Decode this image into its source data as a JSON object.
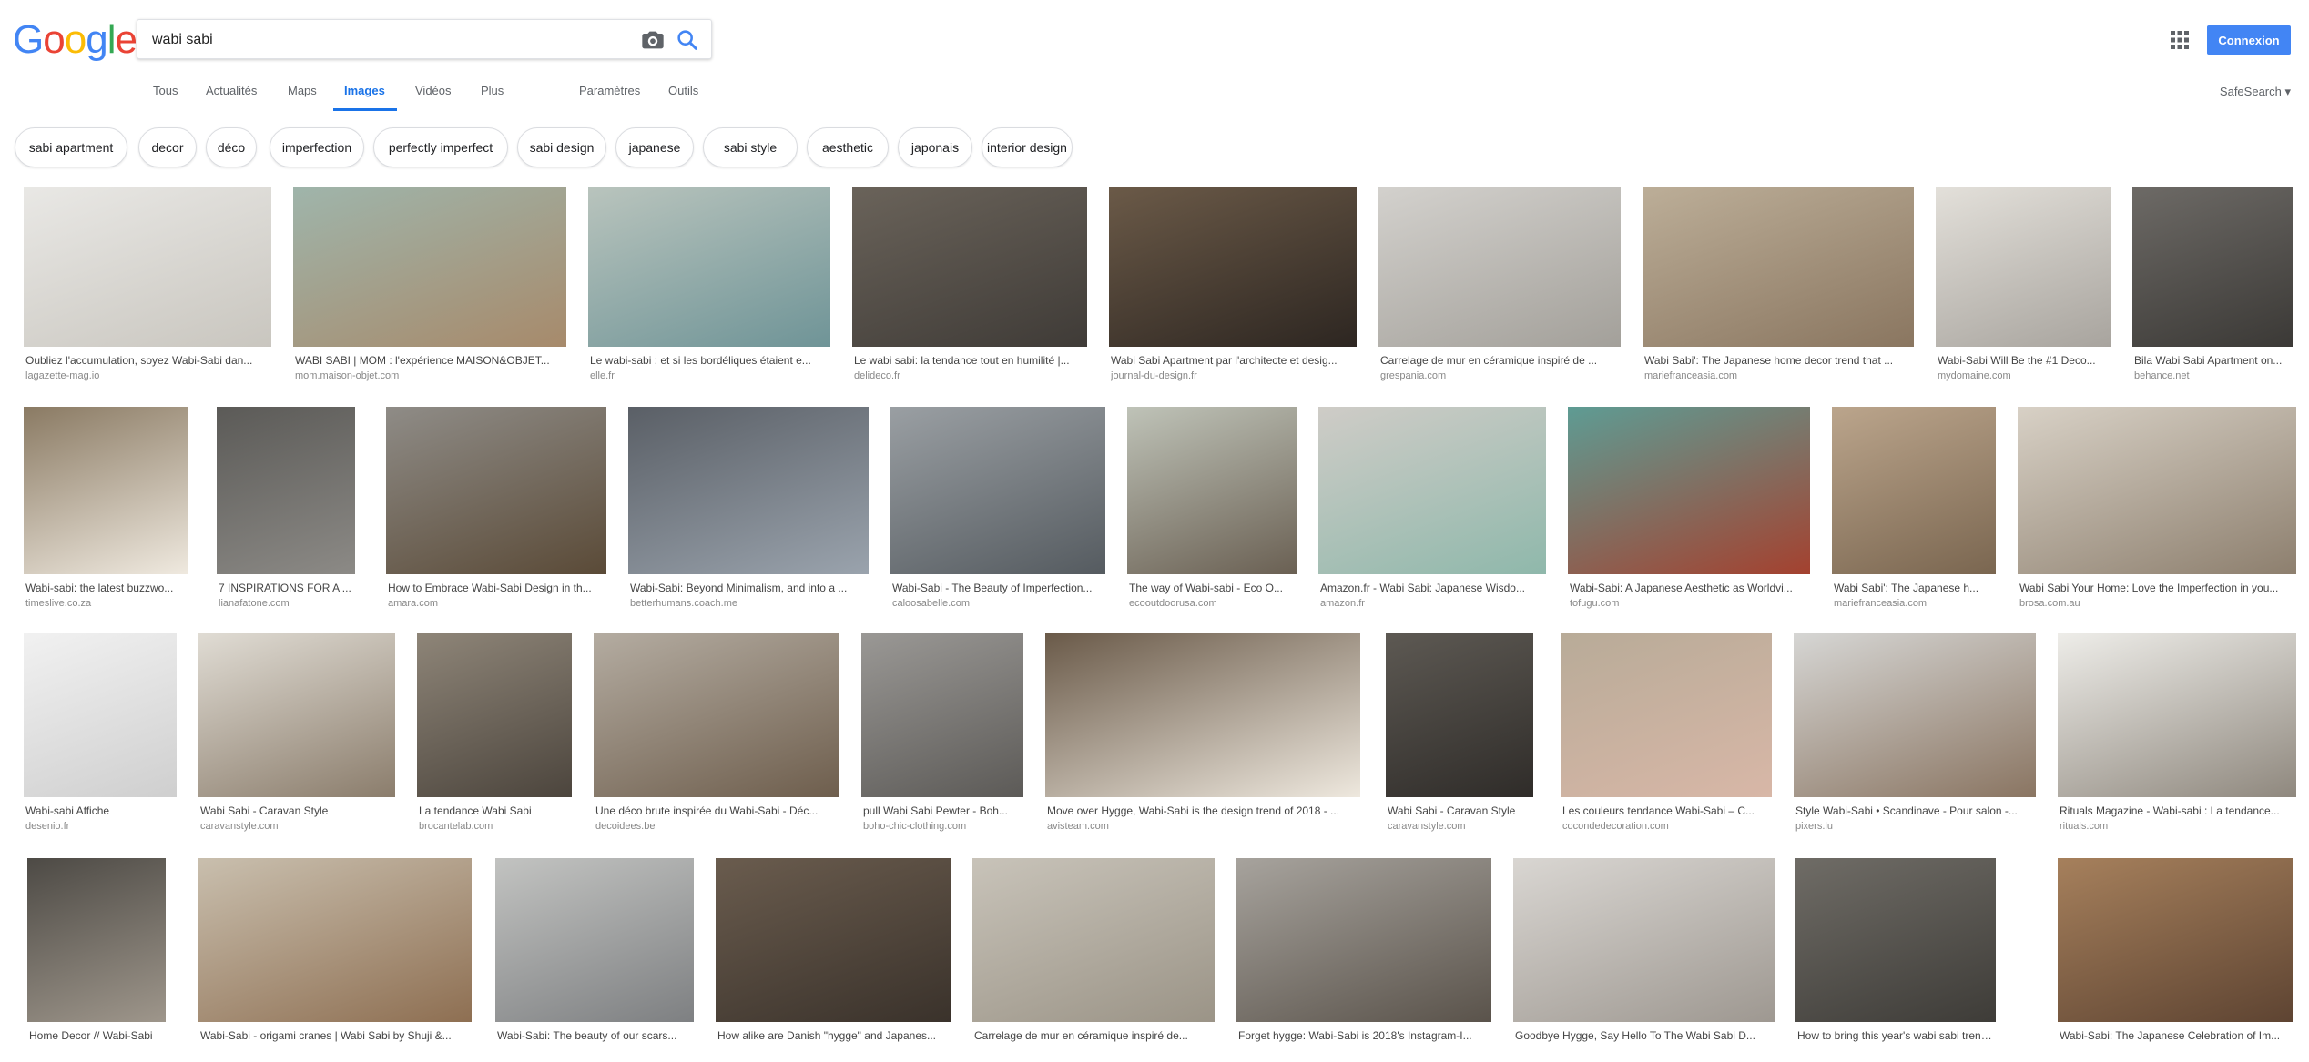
{
  "header": {
    "logo": "Google",
    "logo_colors": [
      "#4285f4",
      "#ea4335",
      "#fbbc05",
      "#4285f4",
      "#34a853",
      "#ea4335"
    ],
    "search_value": "wabi sabi",
    "signin_label": "Connexion",
    "safesearch": "SafeSearch ▾"
  },
  "tabs": [
    {
      "label": "Tous"
    },
    {
      "label": "Actualités"
    },
    {
      "label": "Maps"
    },
    {
      "label": "Images",
      "active": true
    },
    {
      "label": "Vidéos"
    },
    {
      "label": "Plus"
    },
    {
      "label": "Paramètres"
    },
    {
      "label": "Outils"
    }
  ],
  "chips": [
    "sabi apartment",
    "decor",
    "déco",
    "imperfection",
    "perfectly imperfect",
    "sabi design",
    "japanese",
    "sabi style",
    "aesthetic",
    "japonais",
    "interior design"
  ],
  "rows": [
    {
      "tiles": [
        {
          "caption": "Oubliez l'accumulation, soyez Wabi-Sabi dan...",
          "domain": "lagazette-mag.io",
          "c1": "#e9e8e5",
          "c2": "#c9c6bf"
        },
        {
          "caption": "WABI SABI | MOM : l'expérience MAISON&OBJET...",
          "domain": "mom.maison-objet.com",
          "c1": "#9fb5ab",
          "c2": "#a78a6b"
        },
        {
          "caption": "Le wabi-sabi : et si les bordéliques étaient e...",
          "domain": "elle.fr",
          "c1": "#b9c4bd",
          "c2": "#6f9497"
        },
        {
          "caption": "Le wabi sabi: la tendance tout en humilité |...",
          "domain": "delideco.fr",
          "c1": "#6a635a",
          "c2": "#3f3b37"
        },
        {
          "caption": "Wabi Sabi Apartment par l'architecte et desig...",
          "domain": "journal-du-design.fr",
          "c1": "#6b5a48",
          "c2": "#2d2621"
        },
        {
          "caption": "Carrelage de mur en céramique inspiré de ...",
          "domain": "grespania.com",
          "c1": "#d3d1cd",
          "c2": "#a3a09a"
        },
        {
          "caption": "Wabi Sabi': The Japanese home decor trend that ...",
          "domain": "mariefranceasia.com",
          "c1": "#bcae98",
          "c2": "#8a7660"
        },
        {
          "caption": "Wabi-Sabi Will Be the #1 Deco...",
          "domain": "mydomaine.com",
          "c1": "#e3e0da",
          "c2": "#a8a49e"
        },
        {
          "caption": "Bila Wabi Sabi Apartment on...",
          "domain": "behance.net",
          "c1": "#6d6a66",
          "c2": "#3b3936"
        }
      ]
    },
    {
      "tiles": [
        {
          "caption": "Wabi-sabi: the latest buzzwo...",
          "domain": "timeslive.co.za",
          "c1": "#8a7a63",
          "c2": "#efe9df"
        },
        {
          "caption": "7 INSPIRATIONS FOR A ...",
          "domain": "lianafatone.com",
          "c1": "#5b5a57",
          "c2": "#8c8a86"
        },
        {
          "caption": "How to Embrace Wabi-Sabi Design in th...",
          "domain": "amara.com",
          "c1": "#8f8c87",
          "c2": "#5a4a37"
        },
        {
          "caption": "Wabi-Sabi: Beyond Minimalism, and into a ...",
          "domain": "betterhumans.coach.me",
          "c1": "#5a5f66",
          "c2": "#9aa3ad"
        },
        {
          "caption": "Wabi-Sabi - The Beauty of Imperfection...",
          "domain": "caloosabelle.com",
          "c1": "#9a9fa3",
          "c2": "#555b60"
        },
        {
          "caption": "The way of Wabi-sabi - Eco O...",
          "domain": "ecooutdoorusa.com",
          "c1": "#bfc3b8",
          "c2": "#6a6053"
        },
        {
          "caption": "Amazon.fr - Wabi Sabi: Japanese Wisdo...",
          "domain": "amazon.fr",
          "c1": "#cfccc7",
          "c2": "#8fb8ab"
        },
        {
          "caption": "Wabi-Sabi: A Japanese Aesthetic as Worldvi...",
          "domain": "tofugu.com",
          "c1": "#5e9c94",
          "c2": "#a4412f"
        },
        {
          "caption": "Wabi Sabi': The Japanese h...",
          "domain": "mariefranceasia.com",
          "c1": "#bba58c",
          "c2": "#7a6650"
        },
        {
          "caption": "Wabi Sabi Your Home: Love the Imperfection in you...",
          "domain": "brosa.com.au",
          "c1": "#d8d1c6",
          "c2": "#8d7f6e"
        }
      ]
    },
    {
      "tiles": [
        {
          "caption": "Wabi-sabi Affiche",
          "domain": "desenio.fr",
          "c1": "#f1f1f1",
          "c2": "#cfcfcf"
        },
        {
          "caption": "Wabi Sabi - Caravan Style",
          "domain": "caravanstyle.com",
          "c1": "#e0dcd4",
          "c2": "#8b7d6c"
        },
        {
          "caption": "La tendance Wabi Sabi",
          "domain": "brocantelab.com",
          "c1": "#8e8578",
          "c2": "#4c453d"
        },
        {
          "caption": "Une déco brute inspirée du Wabi-Sabi - Déc...",
          "domain": "decoidees.be",
          "c1": "#b4aca1",
          "c2": "#6e5e4d"
        },
        {
          "caption": "pull Wabi Sabi Pewter - Boh...",
          "domain": "boho-chic-clothing.com",
          "c1": "#9a9895",
          "c2": "#5c5a57"
        },
        {
          "caption": "Move over Hygge, Wabi-Sabi is the design trend of 2018 - ...",
          "domain": "avisteam.com",
          "c1": "#6a5a49",
          "c2": "#eee8de"
        },
        {
          "caption": "Wabi Sabi - Caravan Style",
          "domain": "caravanstyle.com",
          "c1": "#5d5953",
          "c2": "#2f2c29"
        },
        {
          "caption": "Les couleurs tendance Wabi-Sabi – C...",
          "domain": "cocondedecoration.com",
          "c1": "#b8ab98",
          "c2": "#d8b7a7"
        },
        {
          "caption": "Style Wabi-Sabi • Scandinave - Pour salon -...",
          "domain": "pixers.lu",
          "c1": "#d6d6d4",
          "c2": "#8a7562"
        },
        {
          "caption": "Rituals Magazine - Wabi-sabi : La tendance...",
          "domain": "rituals.com",
          "c1": "#eeede9",
          "c2": "#8f887e"
        }
      ]
    },
    {
      "tiles": [
        {
          "caption": "Home Decor // Wabi-Sabi",
          "domain": "",
          "c1": "#4d4a45",
          "c2": "#9e968b"
        },
        {
          "caption": "Wabi-Sabi - origami cranes | Wabi Sabi by Shuji &...",
          "domain": "",
          "c1": "#c9bfae",
          "c2": "#8e6f52"
        },
        {
          "caption": "Wabi-Sabi: The beauty of our scars...",
          "domain": "",
          "c1": "#c2c3c1",
          "c2": "#7e8082"
        },
        {
          "caption": "How alike are Danish \"hygge\" and Japanes...",
          "domain": "",
          "c1": "#6a5c4e",
          "c2": "#3a322b"
        },
        {
          "caption": "Carrelage de mur en céramique inspiré de...",
          "domain": "",
          "c1": "#c8c3b9",
          "c2": "#9b9487"
        },
        {
          "caption": "Forget hygge: Wabi-Sabi is 2018's Instagram-I...",
          "domain": "",
          "c1": "#a7a39d",
          "c2": "#5a534b"
        },
        {
          "caption": "Goodbye Hygge, Say Hello To The Wabi Sabi D...",
          "domain": "",
          "c1": "#d9d6d2",
          "c2": "#9e9891"
        },
        {
          "caption": "How to bring this year's wabi sabi trend into...",
          "domain": "",
          "c1": "#6f6c66",
          "c2": "#3e3c38"
        },
        {
          "caption": "Wabi-Sabi: The Japanese Celebration of Im...",
          "domain": "",
          "c1": "#a6805c",
          "c2": "#5e4432"
        }
      ]
    }
  ]
}
